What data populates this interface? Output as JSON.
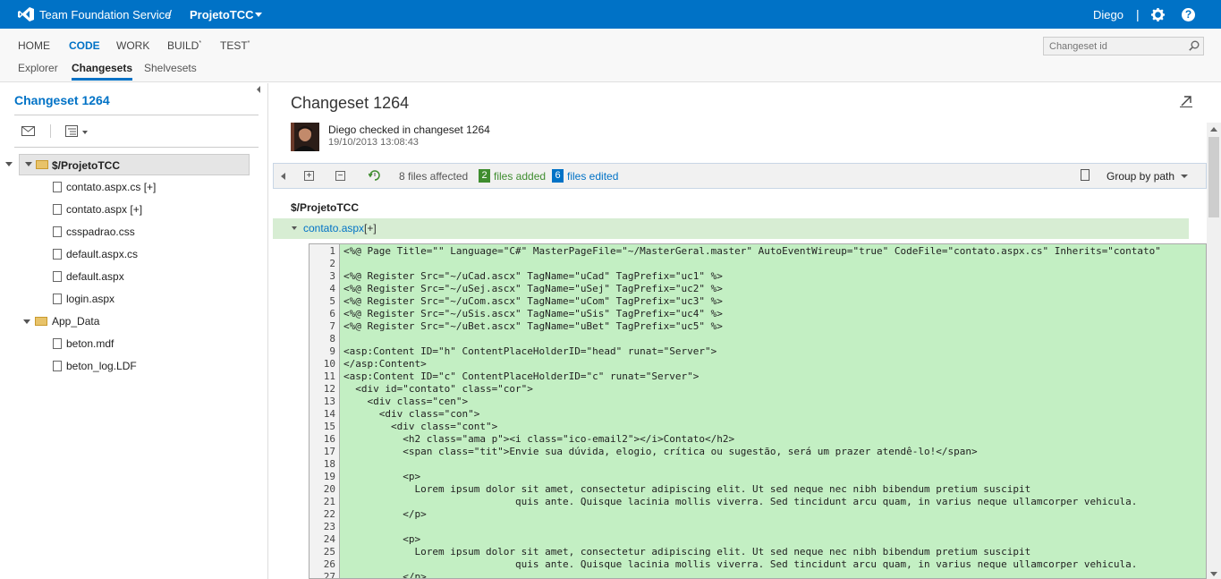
{
  "topbar": {
    "service": "Team Foundation Service",
    "separator": "/",
    "project": "ProjetoTCC",
    "user": "Diego",
    "user_sep": "|",
    "help": "?"
  },
  "nav": {
    "items": [
      "HOME",
      "CODE",
      "WORK",
      "BUILD",
      "TEST"
    ],
    "sup": "*",
    "active": "CODE",
    "sub_items": [
      "Explorer",
      "Changesets",
      "Shelvesets"
    ],
    "active_sub": "Changesets",
    "search_placeholder": "Changeset id"
  },
  "left": {
    "title": "Changeset 1264",
    "root": "$/ProjetoTCC",
    "files": [
      "contato.aspx.cs [+]",
      "contato.aspx [+]",
      "csspadrao.css",
      "default.aspx.cs",
      "default.aspx",
      "login.aspx"
    ],
    "folder": "App_Data",
    "folder_files": [
      "beton.mdf",
      "beton_log.LDF"
    ]
  },
  "main": {
    "title": "Changeset 1264",
    "checkin_text": "Diego checked in changeset 1264",
    "checkin_date": "19/10/2013 13:08:43",
    "toolbar": {
      "files_affected": "8 files affected",
      "added_count": "2",
      "added_label": "files added",
      "edited_count": "6",
      "edited_label": "files edited",
      "group_by": "Group by path"
    },
    "path": "$/ProjetoTCC",
    "file_name": "contato.aspx",
    "file_tag": "[+]",
    "code_lines": [
      "<%@ Page Title=\"\" Language=\"C#\" MasterPageFile=\"~/MasterGeral.master\" AutoEventWireup=\"true\" CodeFile=\"contato.aspx.cs\" Inherits=\"contato\"",
      "",
      "<%@ Register Src=\"~/uCad.ascx\" TagName=\"uCad\" TagPrefix=\"uc1\" %>",
      "<%@ Register Src=\"~/uSej.ascx\" TagName=\"uSej\" TagPrefix=\"uc2\" %>",
      "<%@ Register Src=\"~/uCom.ascx\" TagName=\"uCom\" TagPrefix=\"uc3\" %>",
      "<%@ Register Src=\"~/uSis.ascx\" TagName=\"uSis\" TagPrefix=\"uc4\" %>",
      "<%@ Register Src=\"~/uBet.ascx\" TagName=\"uBet\" TagPrefix=\"uc5\" %>",
      "",
      "<asp:Content ID=\"h\" ContentPlaceHolderID=\"head\" runat=\"Server\">",
      "</asp:Content>",
      "<asp:Content ID=\"c\" ContentPlaceHolderID=\"c\" runat=\"Server\">",
      "  <div id=\"contato\" class=\"cor\">",
      "    <div class=\"cen\">",
      "      <div class=\"con\">",
      "        <div class=\"cont\">",
      "          <h2 class=\"ama p\"><i class=\"ico-email2\"></i>Contato</h2>",
      "          <span class=\"tit\">Envie sua dúvida, elogio, crítica ou sugestão, será um prazer atendê-lo!</span>",
      "",
      "          <p>",
      "            Lorem ipsum dolor sit amet, consectetur adipiscing elit. Ut sed neque nec nibh bibendum pretium suscipit",
      "                             quis ante. Quisque lacinia mollis viverra. Sed tincidunt arcu quam, in varius neque ullamcorper vehicula.",
      "          </p>",
      "",
      "          <p>",
      "            Lorem ipsum dolor sit amet, consectetur adipiscing elit. Ut sed neque nec nibh bibendum pretium suscipit",
      "                             quis ante. Quisque lacinia mollis viverra. Sed tincidunt arcu quam, in varius neque ullamcorper vehicula.",
      "          </p>"
    ]
  }
}
